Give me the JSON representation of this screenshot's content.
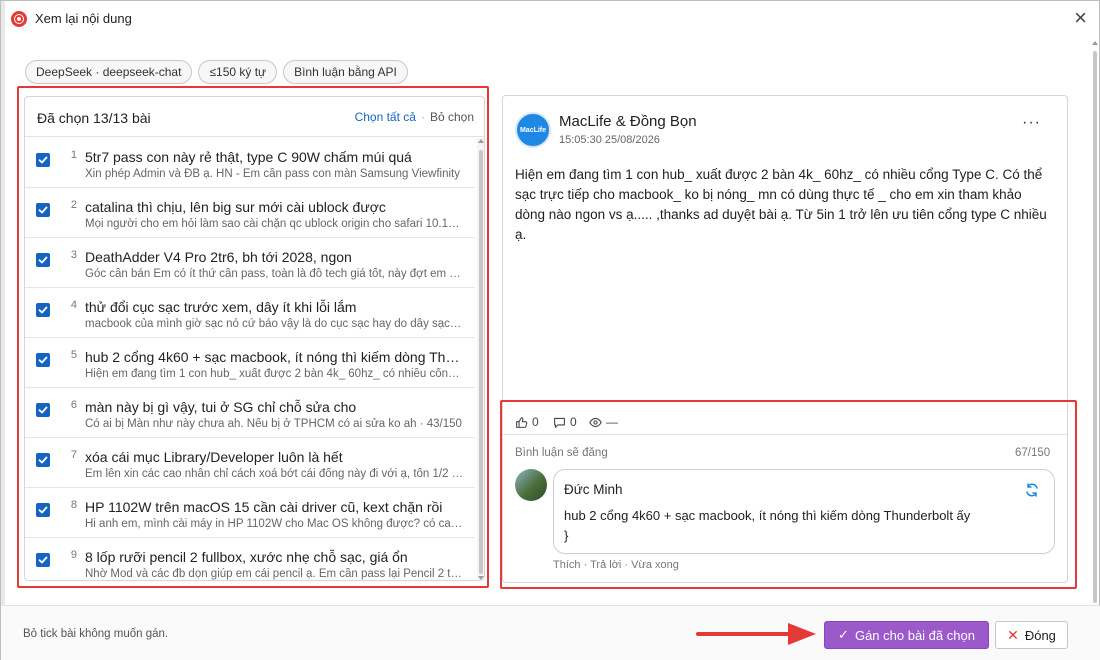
{
  "window": {
    "title": "Xem lại nội dung"
  },
  "chips": [
    "DeepSeek · deepseek-chat",
    "≤150 ký tự",
    "Bình luận bằng API"
  ],
  "list": {
    "count_label": "Đã chọn 13/13 bài",
    "select_all": "Chọn tất cả",
    "separator": "·",
    "deselect": "Bỏ chọn",
    "items": [
      {
        "num": "1",
        "title": "5tr7 pass con này rẻ thật, type C 90W chấm múi quá",
        "snippet": "Xin phép Admin và ĐB ạ. HN - Em cần pass con màn Samsung Viewfinity",
        "checked": true
      },
      {
        "num": "2",
        "title": "catalina thì chịu, lên big sur mới cài ublock được",
        "snippet": "Mọi người cho em hỏi làm sao cài chặn qc ublock origin cho safari 10.15…",
        "checked": true
      },
      {
        "num": "3",
        "title": "DeathAdder V4 Pro 2tr6, bh tới 2028, ngon",
        "snippet": "Góc cần bán Em có ít thứ cần pass, toàn là đồ tech giá tốt, này đợt em …",
        "checked": true
      },
      {
        "num": "4",
        "title": "thử đổi cục sạc trước xem, dây ít khi lỗi lắm",
        "snippet": "macbook của mình giờ sạc nó cứ báo vậy là do cục sạc hay do dây sạc…",
        "checked": true
      },
      {
        "num": "5",
        "title": "hub 2 cổng 4k60 + sạc macbook, ít nóng thì kiếm dòng Thunderbolt ấy",
        "snippet": "Hiện em đang tìm 1 con hub_ xuất được 2 bàn 4k_ 60hz_ có nhiều cổng…",
        "checked": true
      },
      {
        "num": "6",
        "title": "màn này bị gì vậy, tui ở SG chỉ chỗ sửa cho",
        "snippet": "Có ai bị Màn như này chưa ah. Nếu bị ở TPHCM có ai sửa ko ah · 43/150",
        "checked": true
      },
      {
        "num": "7",
        "title": "xóa cái mục Library/Developer luôn là hết",
        "snippet": "Em lên xin các cao nhân chỉ cách xoá bớt cái đống này đi với ạ, tốn 1/2 …",
        "checked": true
      },
      {
        "num": "8",
        "title": "HP 1102W trên macOS 15 cần cài driver cũ, kext chặn rồi",
        "snippet": "Hi anh em, mình cài máy in HP 1102W cho Mac OS không được? có cao…",
        "checked": true
      },
      {
        "num": "9",
        "title": "8 lốp rưỡi pencil 2 fullbox, xước nhẹ chỗ sạc, giá ổn",
        "snippet": "Nhờ Mod và các đb dọn giúp em cái pencil ạ. Em cần pass lại Pencil 2 t…",
        "checked": true
      }
    ]
  },
  "post": {
    "avatar_text": "MacLife",
    "page_name": "MacLife & Đồng Bọn",
    "time": "15:05:30 25/08/2026",
    "more": "···",
    "body": "Hiện em đang tìm 1 con hub_ xuất được 2 bàn 4k_ 60hz_ có nhiều cổng Type C.  Có thể sạc trực tiếp cho macbook_ ko bị nóng_ mn có dùng thực tế _ cho em xin tham khảo dòng nào ngon vs ạ..... ,thanks ad duyệt bài ạ. Từ 5in 1 trở lên ưu tiên cổng type C nhiều ạ.",
    "likes": "0",
    "comments": "0",
    "views": "—"
  },
  "comment": {
    "label": "Bình luận sẽ đăng",
    "count": "67/150",
    "author": "Đức Minh",
    "text_line1": "hub 2 cổng 4k60 + sạc macbook, ít nóng thì kiếm dòng Thunderbolt ấy",
    "text_line2": "}",
    "action_like": "Thích",
    "action_reply": "Trả lời",
    "action_time": "Vừa xong",
    "action_sep": "·"
  },
  "footer": {
    "hint": "Bỏ tick bài không muốn gán.",
    "assign_label": "Gán cho bài đã chọn",
    "close_label": "Đóng"
  },
  "colors": {
    "accent_blue": "#1565c0",
    "assign_purple": "#9b59c9",
    "highlight_red": "#e53935"
  }
}
